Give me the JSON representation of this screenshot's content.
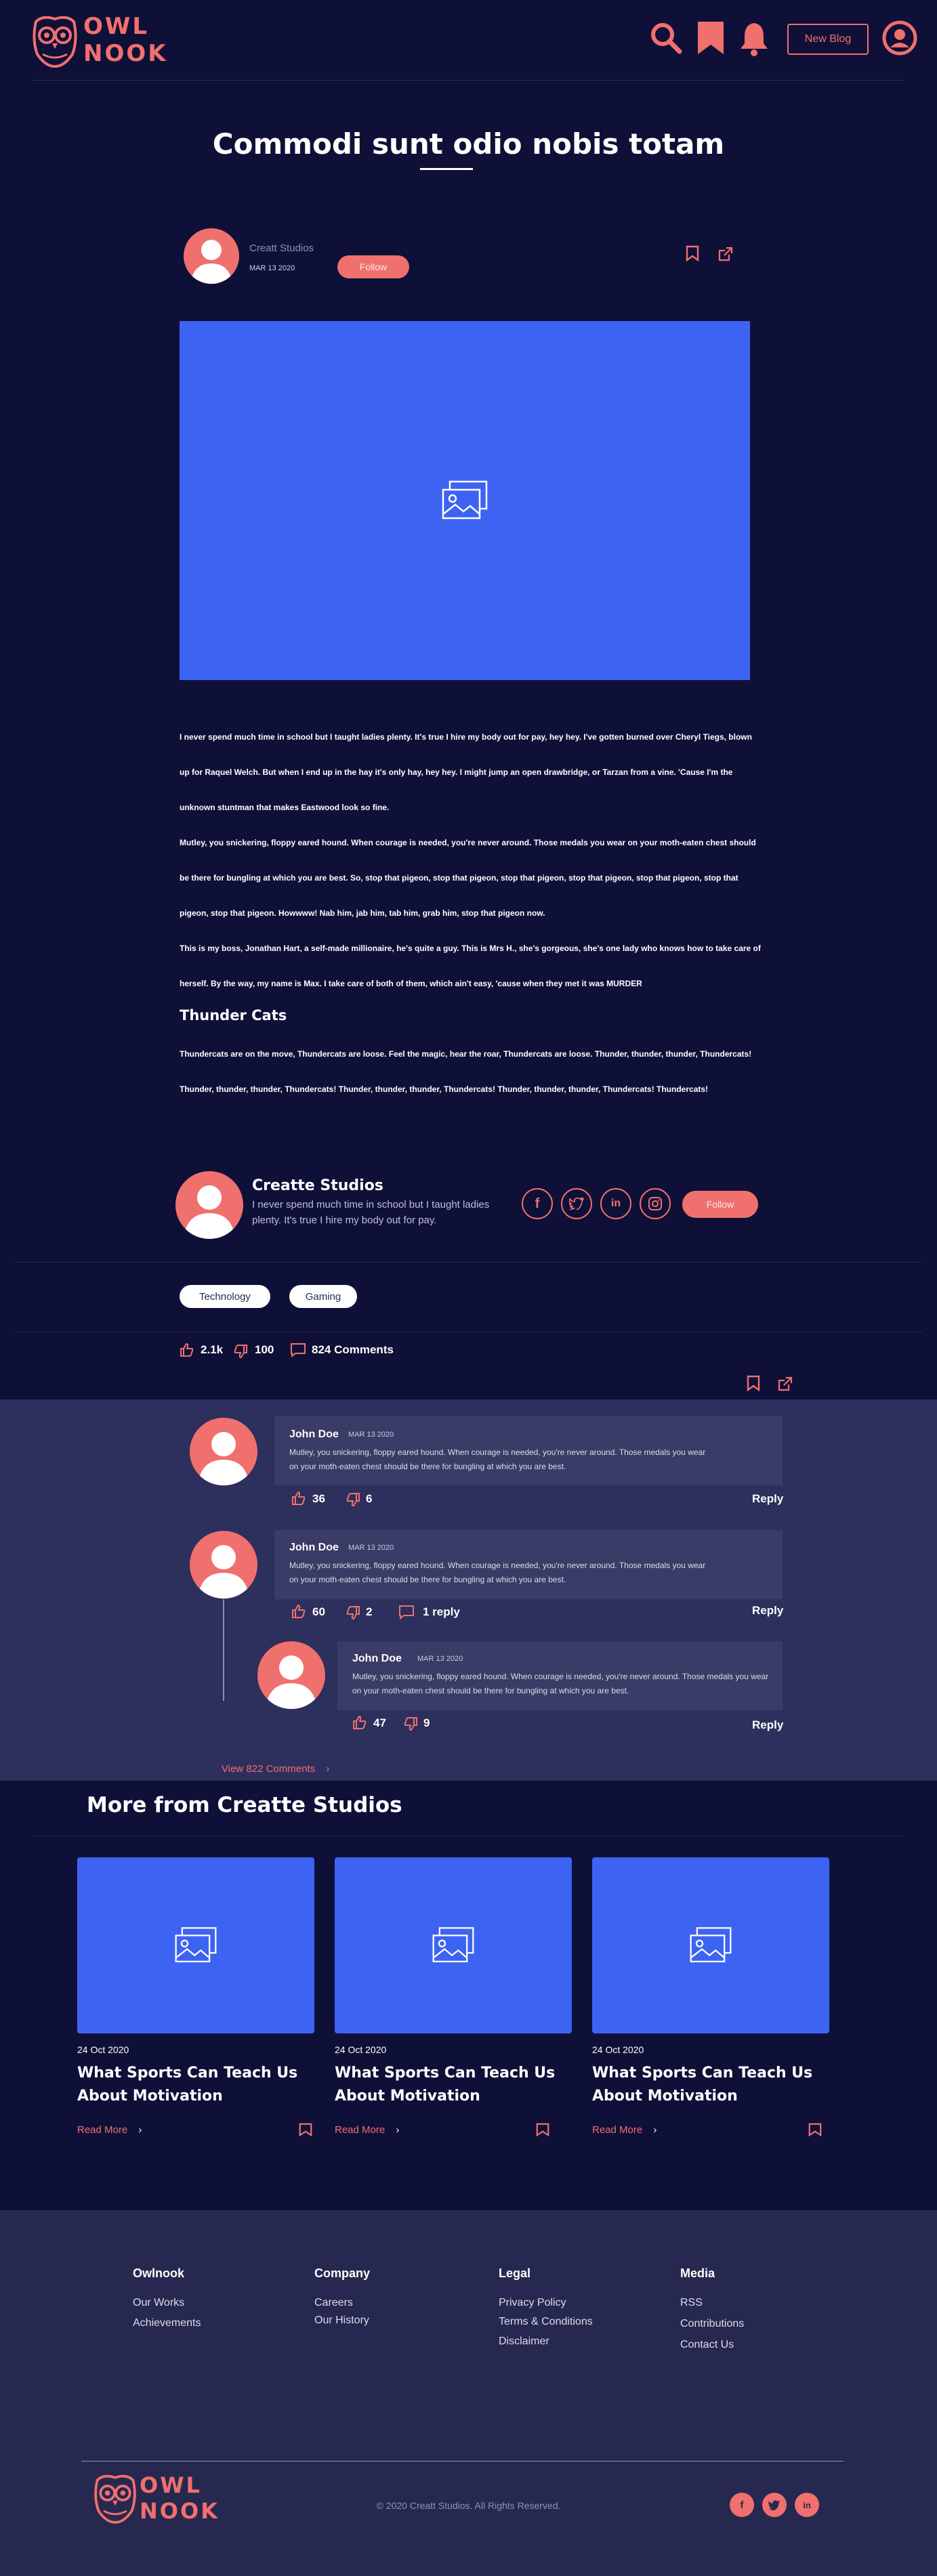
{
  "brand": {
    "logo_line1": "OWL",
    "logo_line2": "NOOK"
  },
  "header": {
    "new_blog_label": "New Blog"
  },
  "article": {
    "title": "Commodi sunt odio nobis totam",
    "author": "Creatt Studios",
    "date": "MAR 13 2020",
    "follow_label": "Follow",
    "paragraphs": [
      "I never spend much time in school but I taught ladies plenty. It's true I hire my body out for pay, hey hey. I've gotten burned over Cheryl Tiegs, blown up for Raquel Welch. But when I end up in the hay it's only hay, hey hey. I might jump an open drawbridge, or Tarzan from a vine. 'Cause I'm the unknown stuntman that makes Eastwood look so fine.",
      "Mutley, you snickering, floppy eared hound. When courage is needed, you're never around. Those medals you wear on your moth-eaten chest should be there for bungling at which you are best. So, stop that pigeon, stop that pigeon, stop that pigeon, stop that pigeon, stop that pigeon, stop that pigeon, stop that pigeon. Howwww! Nab him, jab him, tab him, grab him, stop that pigeon now.",
      "This is my boss, Jonathan Hart, a self-made millionaire, he's quite a guy. This is Mrs H., she's gorgeous, she's one lady who knows how to take care of herself. By the way, my name is Max. I take care of both of them, which ain't easy, 'cause when they met it was MURDER"
    ],
    "subheading": "Thunder Cats",
    "thunder_paragraph": "Thundercats are on the move, Thundercats are loose. Feel the magic, hear the roar, Thundercats are loose. Thunder, thunder, thunder, Thundercats! Thunder, thunder, thunder, Thundercats! Thunder, thunder, thunder, Thundercats! Thunder, thunder, thunder, Thundercats! Thundercats!"
  },
  "creator": {
    "name": "Creatte Studios",
    "bio": "I never spend much time in school but I taught ladies plenty. It's true I hire my body out for pay.",
    "follow_label": "Follow"
  },
  "tags": [
    "Technology",
    "Gaming"
  ],
  "stats": {
    "likes": "2.1k",
    "dislikes": "100",
    "comments": "824 Comments"
  },
  "comments": [
    {
      "name": "John Doe",
      "date": "MAR 13 2020",
      "text": "Mutley, you snickering, floppy eared hound. When courage is needed, you're never around. Those medals you wear on your moth-eaten chest should be there for bungling at which you are best.",
      "likes": "36",
      "dislikes": "6",
      "reply": "Reply"
    },
    {
      "name": "John Doe",
      "date": "MAR 13 2020",
      "text": "Mutley, you snickering, floppy eared hound. When courage is needed, you're never around. Those medals you wear on your moth-eaten chest should be there for bungling at which you are best.",
      "likes": "60",
      "dislikes": "2",
      "replies": "1 reply",
      "reply": "Reply"
    },
    {
      "name": "John Doe",
      "date": "MAR 13 2020",
      "text": "Mutley, you snickering, floppy eared hound. When courage is needed, you're never around. Those medals you wear on your moth-eaten chest should be there for bungling at which you are best.",
      "likes": "47",
      "dislikes": "9",
      "reply": "Reply"
    }
  ],
  "view_comments": "View 822 Comments",
  "more": {
    "title": "More from Creatte Studios",
    "cards": [
      {
        "date": "24 Oct 2020",
        "title": "What Sports Can Teach Us About Motivation",
        "read_more": "Read More"
      },
      {
        "date": "24 Oct 2020",
        "title": "What Sports Can Teach Us About Motivation",
        "read_more": "Read More"
      },
      {
        "date": "24 Oct 2020",
        "title": "What Sports Can Teach Us About Motivation",
        "read_more": "Read More"
      }
    ]
  },
  "footer": {
    "columns": [
      {
        "heading": "Owlnook",
        "links": [
          "Our Works",
          "Achievements"
        ]
      },
      {
        "heading": "Company",
        "links": [
          "Careers",
          "Our History"
        ]
      },
      {
        "heading": "Legal",
        "links": [
          "Privacy Policy",
          "Terms & Conditions",
          "Disclaimer"
        ]
      },
      {
        "heading": "Media",
        "links": [
          "RSS",
          "Contributions",
          "Contact Us"
        ]
      }
    ],
    "copyright": "© 2020 Creatt Studios. All Rights Reserved."
  },
  "colors": {
    "background": "#0f1038",
    "accent": "#f0706e",
    "image_placeholder": "#3d63f2",
    "comments_bg": "#2d2f5c",
    "footer_bg": "#27284f"
  }
}
